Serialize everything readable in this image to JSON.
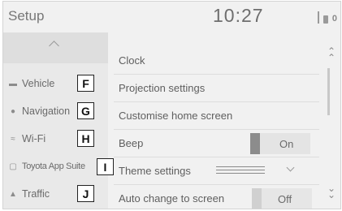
{
  "header": {
    "title": "Setup",
    "clock": "10:27",
    "status_extra": "0"
  },
  "sidebar": {
    "items": [
      {
        "icon": "vehicle-icon",
        "label": "Vehicle"
      },
      {
        "icon": "navigation-icon",
        "label": "Navigation"
      },
      {
        "icon": "wifi-icon",
        "label": "Wi-Fi"
      },
      {
        "icon": "app-suite-icon",
        "label": "Toyota App Suite"
      },
      {
        "icon": "traffic-icon",
        "label": "Traffic"
      }
    ]
  },
  "callouts": [
    "F",
    "G",
    "H",
    "I",
    "J"
  ],
  "settings": {
    "rows": [
      {
        "label": "Clock"
      },
      {
        "label": "Projection settings"
      },
      {
        "label": "Customise home screen"
      },
      {
        "label": "Beep",
        "value": "On"
      },
      {
        "label": "Theme settings"
      },
      {
        "label": "Auto change to screen",
        "value": "Off"
      }
    ]
  },
  "colors": {
    "background": "#f1f1f1",
    "sidebar": "#e9e9e9",
    "toggle_knob": "#8c8c8c"
  }
}
